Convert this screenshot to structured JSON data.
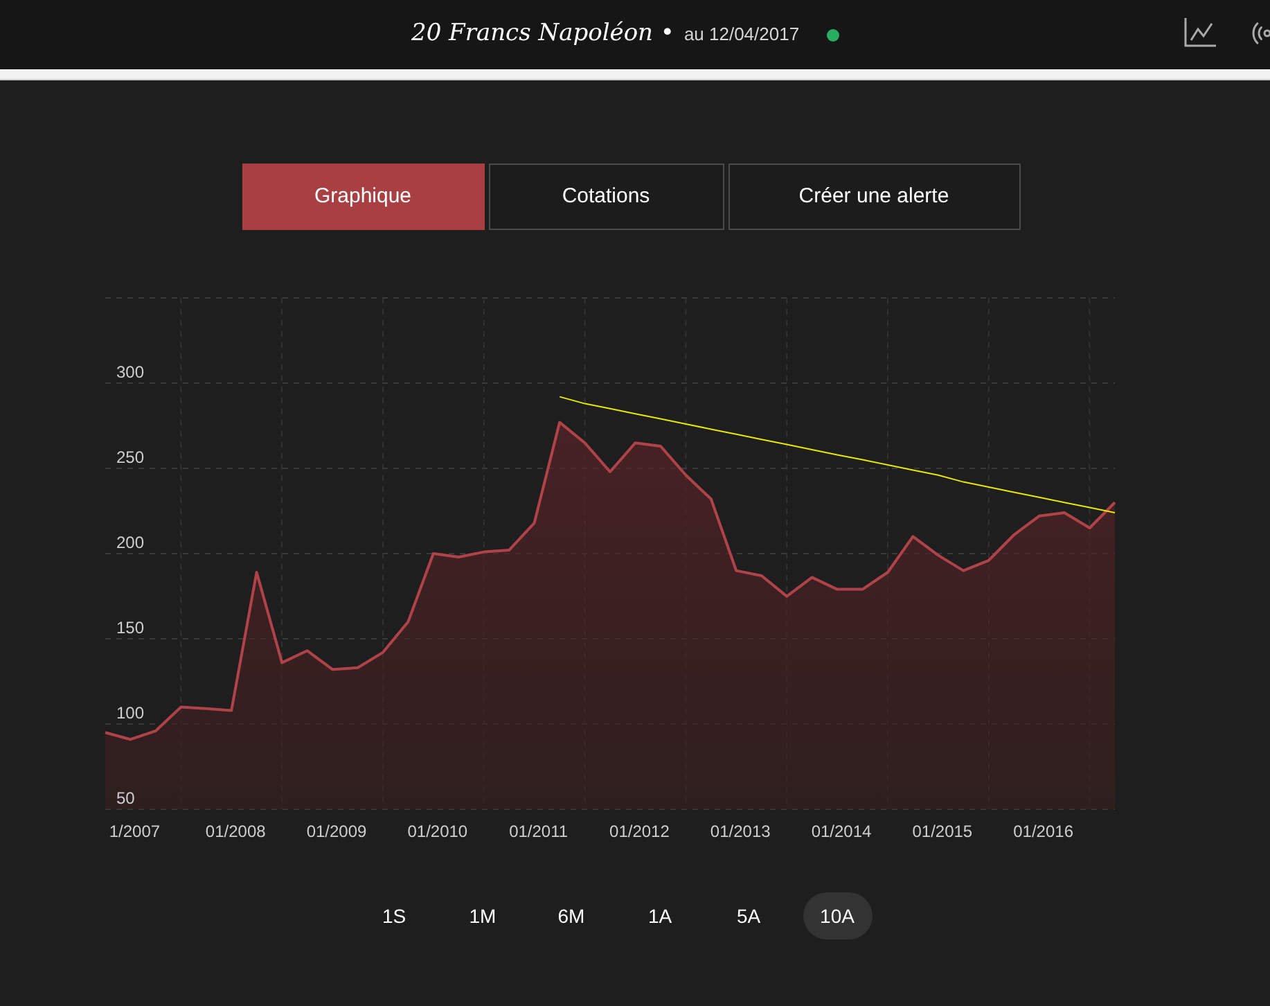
{
  "header": {
    "title": "20 Francs Napoléon •",
    "date": "au 12/04/2017",
    "live": true
  },
  "tabs": [
    {
      "label": "Graphique",
      "selected": true
    },
    {
      "label": "Cotations",
      "selected": false
    },
    {
      "label": "Créer une alerte",
      "selected": false
    }
  ],
  "chart": {
    "chart_data": {
      "type": "area",
      "categories": [
        null,
        "1/2007",
        null,
        null,
        null,
        "01/2008",
        null,
        null,
        null,
        "01/2009",
        null,
        null,
        null,
        "01/2010",
        null,
        null,
        null,
        "01/2011",
        null,
        null,
        null,
        "01/2012",
        null,
        null,
        null,
        "01/2013",
        null,
        null,
        null,
        "01/2014",
        null,
        null,
        null,
        "01/2015",
        null,
        null,
        null,
        "01/2016",
        null,
        null,
        null
      ],
      "series": [
        {
          "color": "#b0434a",
          "values": [
            95,
            91,
            96,
            110,
            109,
            108,
            189,
            136,
            143,
            132,
            133,
            142,
            160,
            200,
            198,
            201,
            202,
            218,
            277,
            265,
            248,
            265,
            263,
            246,
            232,
            190,
            187,
            175,
            186,
            179,
            179,
            189,
            210,
            199,
            190,
            196,
            211,
            222,
            224,
            215,
            230
          ]
        },
        {
          "type": "line",
          "color": "#e8e800",
          "values": [
            null,
            null,
            null,
            null,
            null,
            null,
            null,
            null,
            null,
            null,
            null,
            null,
            null,
            null,
            null,
            null,
            null,
            null,
            292,
            288,
            285,
            282,
            279,
            276,
            273,
            270,
            267,
            264,
            261,
            258,
            255,
            252,
            249,
            246,
            242,
            239,
            236,
            233,
            230,
            227,
            224
          ]
        }
      ],
      "grid": true,
      "ylim": [
        50,
        350
      ],
      "yticks": [
        50,
        100,
        150,
        200,
        250,
        300
      ]
    }
  },
  "ranges": [
    {
      "label": "1S",
      "selected": false
    },
    {
      "label": "1M",
      "selected": false
    },
    {
      "label": "6M",
      "selected": false
    },
    {
      "label": "1A",
      "selected": false
    },
    {
      "label": "5A",
      "selected": false
    },
    {
      "label": "10A",
      "selected": true
    }
  ]
}
